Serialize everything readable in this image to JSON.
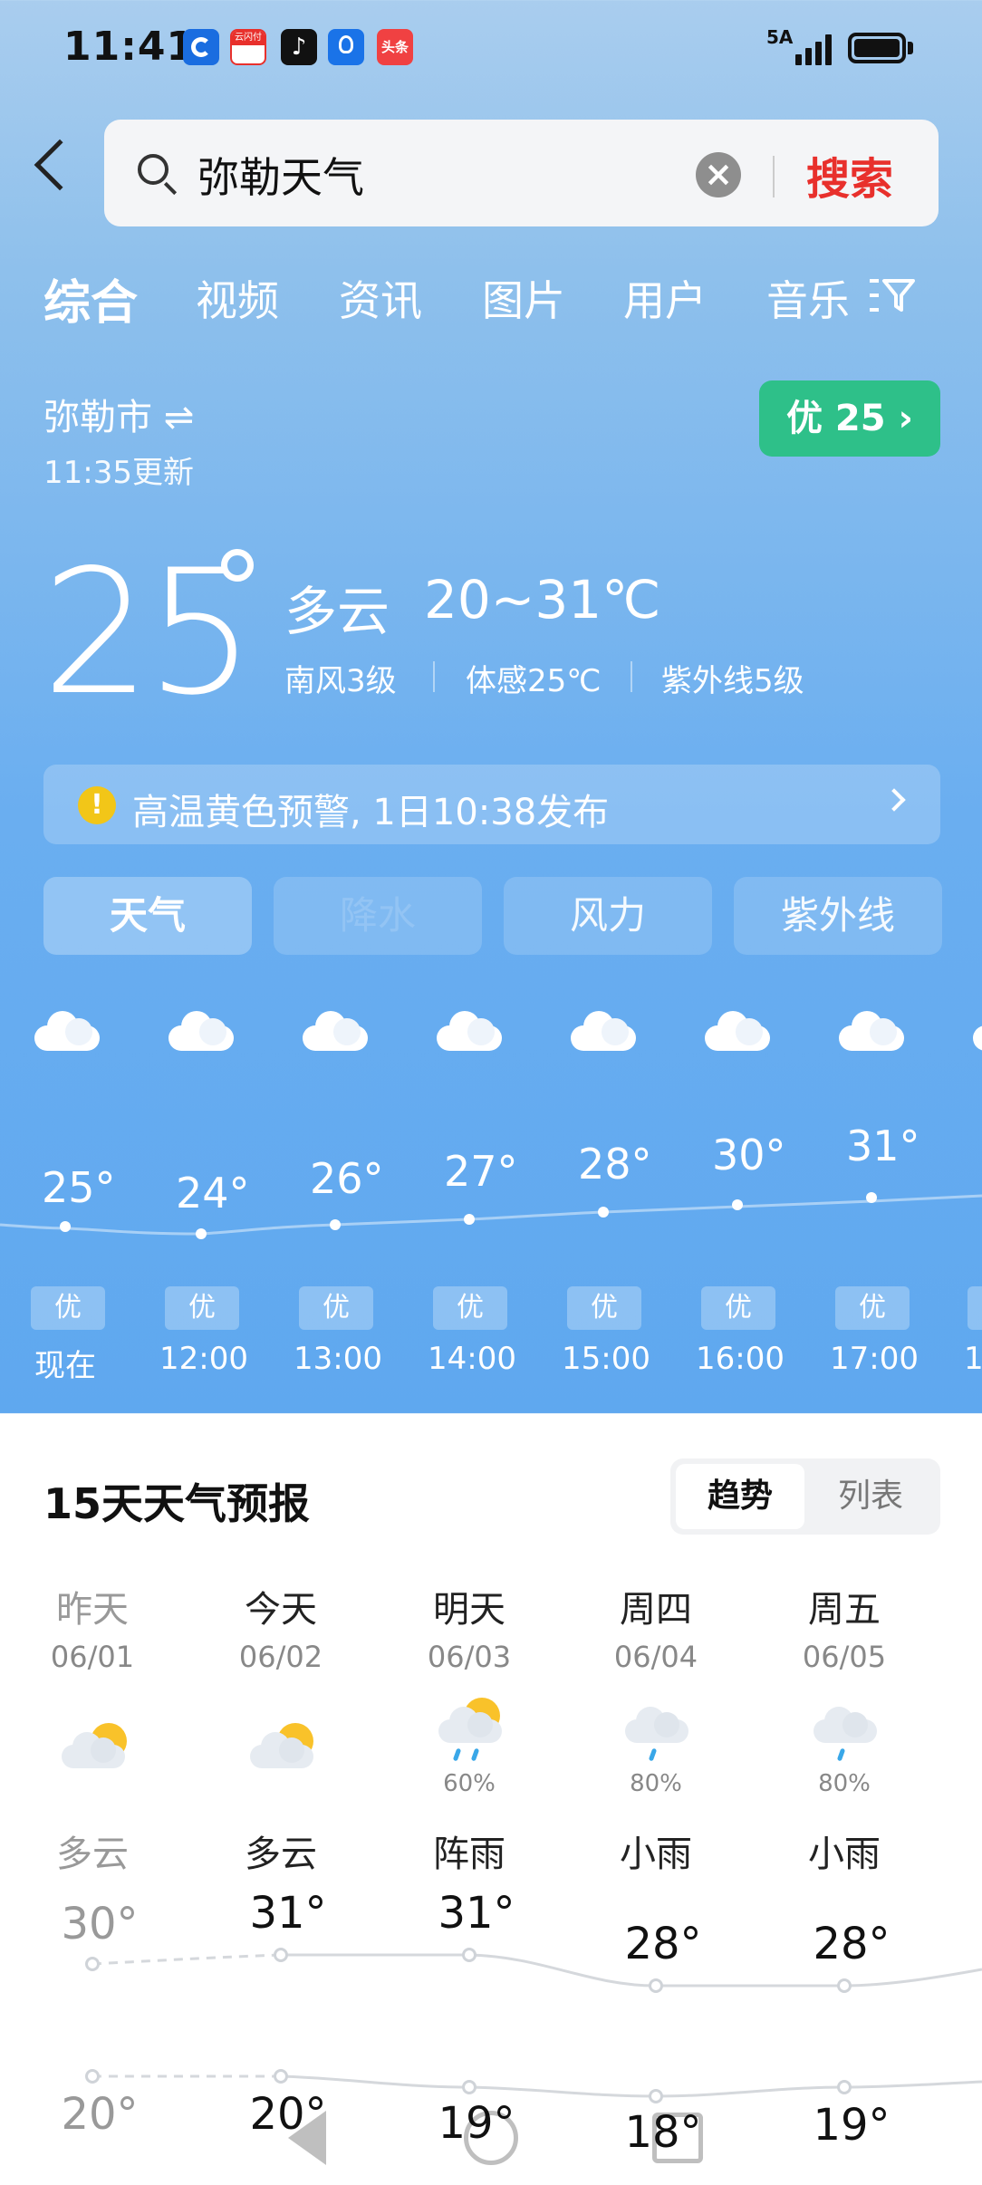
{
  "status_bar": {
    "time": "11:41",
    "network": "5A",
    "apps": [
      {
        "name": "browser-app-icon",
        "color": "#1a6de0"
      },
      {
        "name": "cloud-pay-app-icon",
        "color": "#e8302c"
      },
      {
        "name": "douyin-app-icon",
        "color": "#111111"
      },
      {
        "name": "bulb-app-icon",
        "color": "#1a73e8"
      },
      {
        "name": "toutiao-app-icon",
        "color": "#f04142"
      }
    ],
    "cloud_pay_label": "云闪付",
    "toutiao_label": "头条"
  },
  "search": {
    "query": "弥勒天气",
    "button_label": "搜索"
  },
  "tabs": [
    "综合",
    "视频",
    "资讯",
    "图片",
    "用户",
    "音乐"
  ],
  "location": {
    "city": "弥勒市 ⇌",
    "updated": "11:35更新",
    "aqi_badge": "优 25 ›"
  },
  "current": {
    "temp": "25",
    "condition": "多云",
    "range": "20~31℃",
    "wind": "南风3级",
    "feels_like": "体感25℃",
    "uv": "紫外线5级"
  },
  "alert": {
    "icon": "!",
    "text": "高温黄色预警, 1日10:38发布"
  },
  "sub_tabs": [
    "天气",
    "降水",
    "风力",
    "紫外线"
  ],
  "hourly": [
    {
      "time": "现在",
      "temp": "25°",
      "aqi": "优"
    },
    {
      "time": "12:00",
      "temp": "24°",
      "aqi": "优"
    },
    {
      "time": "13:00",
      "temp": "26°",
      "aqi": "优"
    },
    {
      "time": "14:00",
      "temp": "27°",
      "aqi": "优"
    },
    {
      "time": "15:00",
      "temp": "28°",
      "aqi": "优"
    },
    {
      "time": "16:00",
      "temp": "30°",
      "aqi": "优"
    },
    {
      "time": "17:00",
      "temp": "31°",
      "aqi": "优"
    },
    {
      "time": "1",
      "temp": "",
      "aqi": "优"
    }
  ],
  "forecast": {
    "title": "15天天气预报",
    "toggle_on": "趋势",
    "toggle_off": "列表",
    "days": [
      {
        "name": "昨天",
        "date": "06/01",
        "icon": "partly-cloudy",
        "precip": "",
        "cond": "多云",
        "hi": "30°",
        "lo": "20°",
        "past": true
      },
      {
        "name": "今天",
        "date": "06/02",
        "icon": "partly-cloudy",
        "precip": "",
        "cond": "多云",
        "hi": "31°",
        "lo": "20°",
        "past": false
      },
      {
        "name": "明天",
        "date": "06/03",
        "icon": "shower",
        "precip": "60%",
        "cond": "阵雨",
        "hi": "31°",
        "lo": "19°",
        "past": false
      },
      {
        "name": "周四",
        "date": "06/04",
        "icon": "light-rain",
        "precip": "80%",
        "cond": "小雨",
        "hi": "28°",
        "lo": "18°",
        "past": false
      },
      {
        "name": "周五",
        "date": "06/05",
        "icon": "light-rain",
        "precip": "80%",
        "cond": "小雨",
        "hi": "28°",
        "lo": "19°",
        "past": false
      }
    ]
  }
}
